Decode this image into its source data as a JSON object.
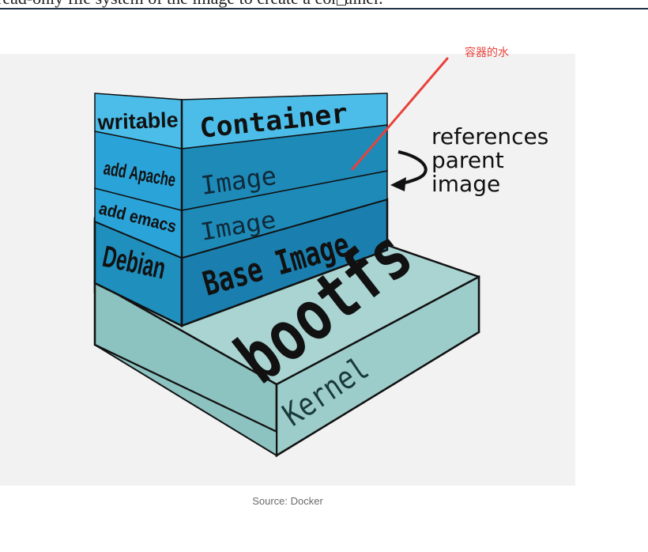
{
  "page": {
    "top_text": "read-only file system of the image to create a container.",
    "caption": "Source: Docker"
  },
  "diagram": {
    "annotation": "容器的水",
    "references_lines": [
      "references",
      "parent",
      "image"
    ],
    "layers": [
      {
        "side": "writable",
        "front": "Container"
      },
      {
        "side": "add Apache",
        "front": "Image"
      },
      {
        "side": "add emacs",
        "front": "Image"
      },
      {
        "side": "Debian",
        "front": "Base Image"
      }
    ],
    "bootfs": "bootfs",
    "kernel": "Kernel"
  },
  "colors": {
    "container_front": "#4bbde8",
    "container_top": "#7fd2f0",
    "image_front": "#1e8ab8",
    "base_front": "#1a7fae",
    "side_face": "#2aa3d8",
    "bootfs_top": "#a9d4d2",
    "bootfs_front": "#9dcdcb",
    "annotation_red": "#e8423a",
    "outline": "#111111"
  }
}
